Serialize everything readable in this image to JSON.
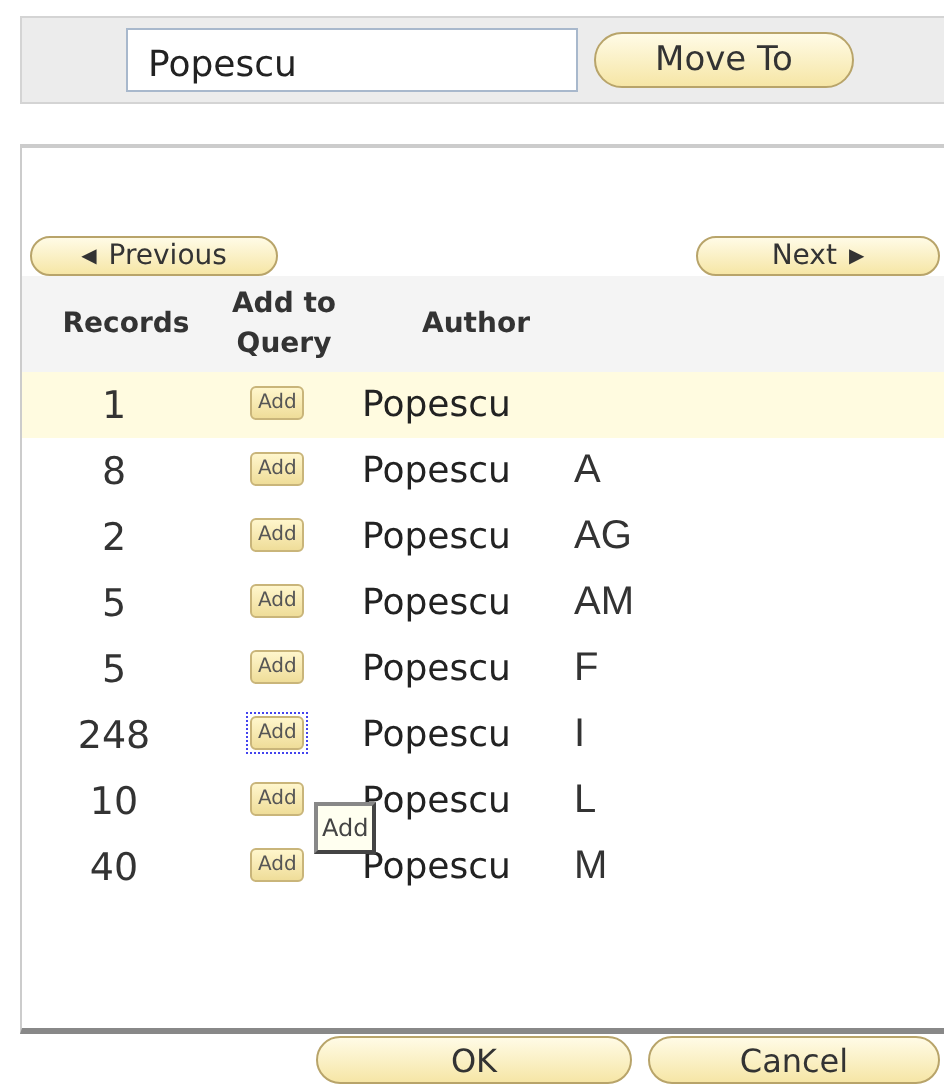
{
  "search": {
    "value": "Popescu",
    "button": "Move To"
  },
  "pager": {
    "previous": "Previous",
    "previous_icon": "◀",
    "next": "Next",
    "next_icon": "▶"
  },
  "table": {
    "columns": [
      "Records",
      "Add to Query",
      "Author"
    ],
    "rows": [
      {
        "records": "1",
        "add": "Add",
        "surname": "Popescu",
        "selected": true,
        "focused": false
      },
      {
        "records": "8",
        "add": "Add",
        "surname": "Popescu",
        "initials": "A",
        "selected": false,
        "focused": false
      },
      {
        "records": "2",
        "add": "Add",
        "surname": "Popescu",
        "initials": "AG",
        "selected": false,
        "focused": false
      },
      {
        "records": "5",
        "add": "Add",
        "surname": "Popescu",
        "initials": "AM",
        "selected": false,
        "focused": false
      },
      {
        "records": "5",
        "add": "Add",
        "surname": "Popescu",
        "initials": "F",
        "selected": false,
        "focused": false
      },
      {
        "records": "248",
        "add": "Add",
        "surname": "Popescu",
        "initials": "I",
        "selected": false,
        "focused": true
      },
      {
        "records": "10",
        "add": "Add",
        "surname": "Popescu",
        "initials": "L",
        "selected": false,
        "focused": false,
        "tooltip": "Add"
      },
      {
        "records": "40",
        "add": "Add",
        "surname": "Popescu",
        "initials": "M",
        "selected": false,
        "focused": false
      }
    ]
  },
  "buttons": [
    "OK",
    "Cancel"
  ]
}
